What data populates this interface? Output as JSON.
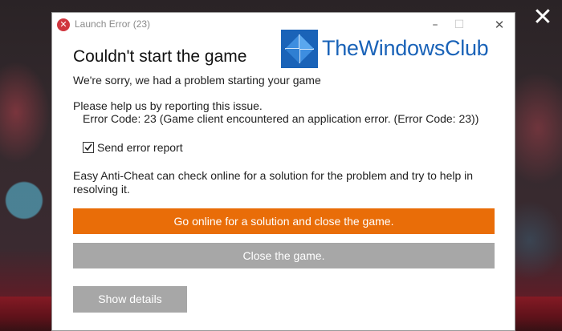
{
  "window": {
    "title": "Launch Error (23)",
    "title_icon": "error-icon",
    "controls": {
      "minimize": "–",
      "maximize": "☐",
      "close": "✕"
    }
  },
  "overlay": {
    "close_glyph": "✕"
  },
  "watermark": {
    "text": "TheWindowsClub",
    "color": "#1a63b8"
  },
  "dialog": {
    "heading": "Couldn't start the game",
    "subheading": "We're sorry, we had a problem starting your game",
    "report_label": "Please help us by reporting this issue.",
    "error_code": "Error Code: 23 (Game client encountered an application error. (Error Code: 23))",
    "send_report": {
      "label": "Send error report",
      "checked": true
    },
    "eac_message": "Easy Anti-Cheat can check online for a solution for the problem and try to help in resolving it."
  },
  "buttons": {
    "online_label": "Go online for a solution and close the game.",
    "close_label": "Close the game.",
    "details_label": "Show details"
  },
  "colors": {
    "primary_button": "#e96d08",
    "secondary_button": "#a7a7a7",
    "error_icon": "#d0363f"
  }
}
